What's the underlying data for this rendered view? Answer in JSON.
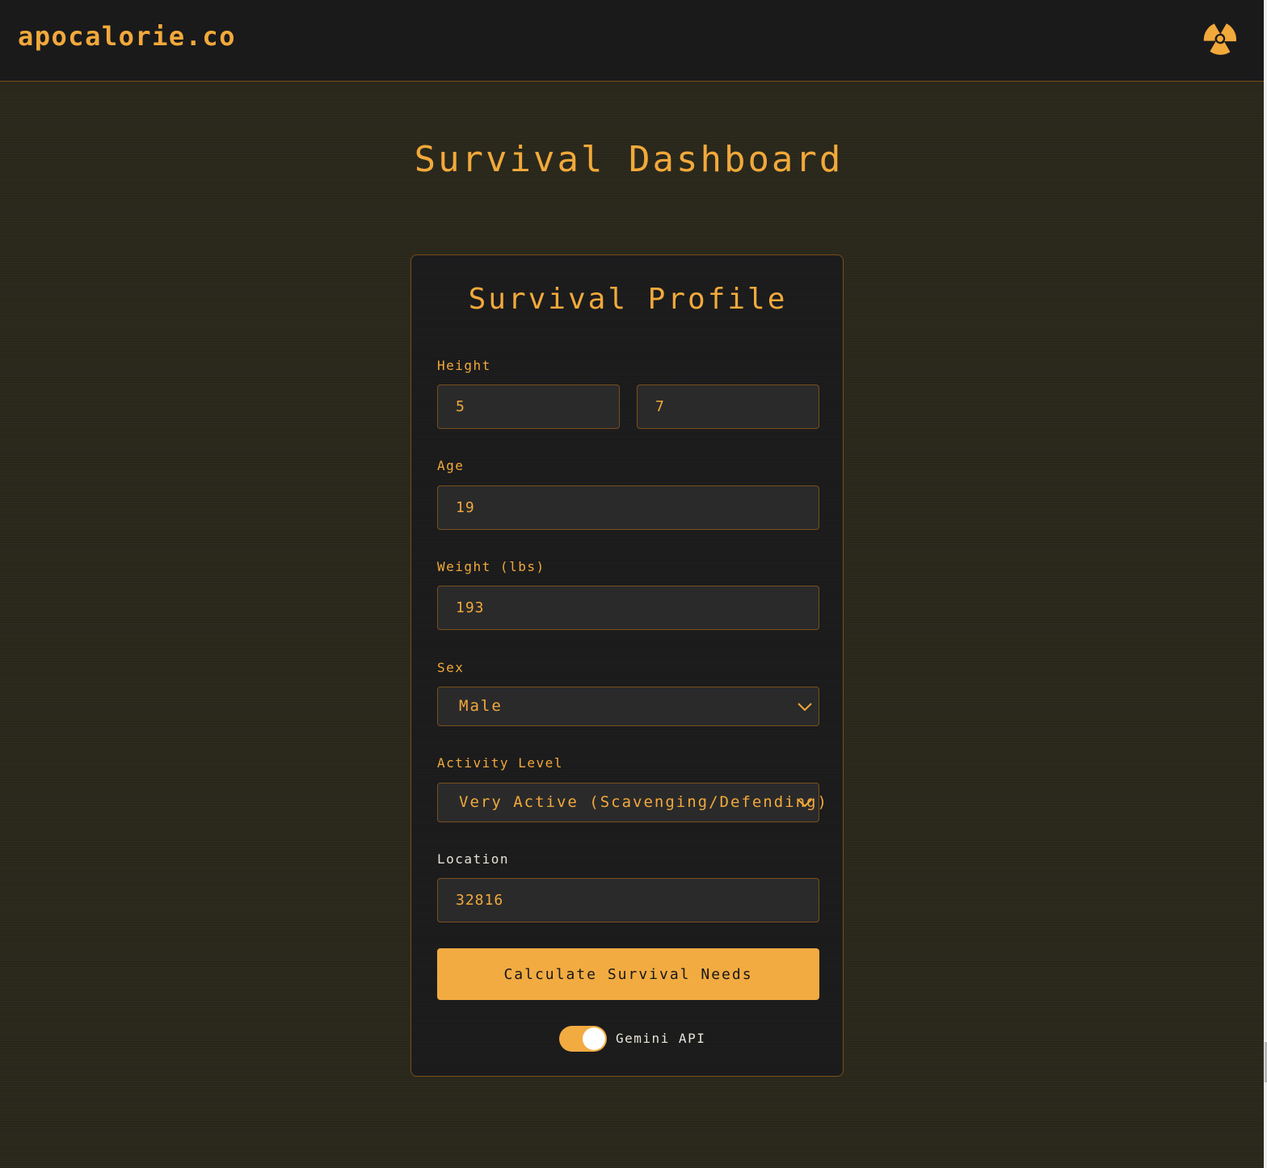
{
  "header": {
    "brand": "apocalorie.co",
    "icon": "radiation-icon"
  },
  "page": {
    "title": "Survival Dashboard"
  },
  "profile": {
    "title": "Survival Profile",
    "height": {
      "label": "Height",
      "feet": "5",
      "inches": "7"
    },
    "age": {
      "label": "Age",
      "value": "19"
    },
    "weight": {
      "label": "Weight (lbs)",
      "value": "193"
    },
    "sex": {
      "label": "Sex",
      "selected": "Male"
    },
    "activity": {
      "label": "Activity Level",
      "selected": "Very Active (Scavenging/Defending)"
    },
    "location": {
      "label": "Location",
      "value": "32816"
    },
    "submit_label": "Calculate Survival Needs",
    "api_toggle": {
      "label": "Gemini API",
      "on": true
    }
  },
  "colors": {
    "accent": "#f2a93b",
    "background": "#2c2a1d",
    "panel": "#1b1b1c",
    "field": "#2a2a2b",
    "border": "#7a4f1c"
  }
}
